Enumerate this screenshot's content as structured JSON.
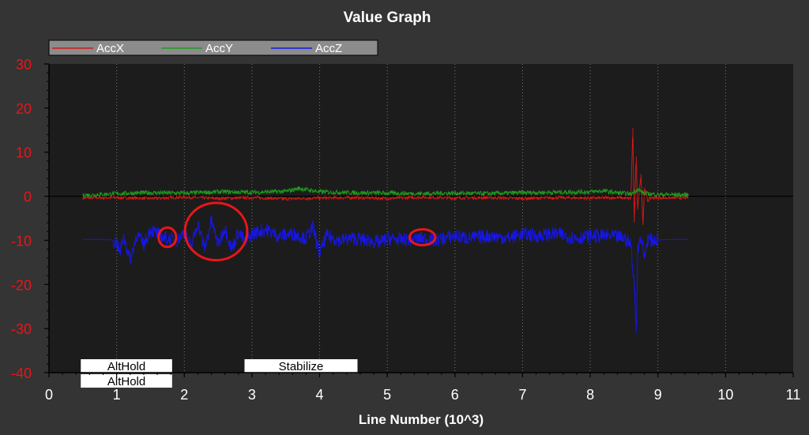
{
  "chart_data": {
    "type": "line",
    "title": "Value Graph",
    "xlabel": "Line Number (10^3)",
    "ylabel": "",
    "xlim": [
      0,
      11
    ],
    "ylim": [
      -40,
      30
    ],
    "x_ticks": [
      "0",
      "1",
      "2",
      "3",
      "4",
      "5",
      "6",
      "7",
      "8",
      "9",
      "10",
      "11"
    ],
    "y_ticks": [
      "30",
      "20",
      "10",
      "0",
      "-10",
      "-20",
      "-30",
      "-40"
    ],
    "grid": "vertical dotted",
    "legend_placement": "top-left",
    "series": [
      {
        "name": "AccX",
        "color": "#d01818",
        "points": [
          [
            0.5,
            -0.4
          ],
          [
            1.0,
            -0.3
          ],
          [
            1.5,
            -0.5
          ],
          [
            2.0,
            -0.2
          ],
          [
            2.5,
            -0.5
          ],
          [
            3.0,
            -0.3
          ],
          [
            3.5,
            -0.6
          ],
          [
            4.0,
            -0.4
          ],
          [
            4.5,
            -0.3
          ],
          [
            5.0,
            -0.5
          ],
          [
            5.5,
            -0.2
          ],
          [
            6.0,
            -0.4
          ],
          [
            6.5,
            -0.3
          ],
          [
            7.0,
            -0.5
          ],
          [
            7.5,
            -0.3
          ],
          [
            8.0,
            -0.4
          ],
          [
            8.4,
            -0.3
          ],
          [
            8.6,
            -0.5
          ],
          [
            8.63,
            15.5
          ],
          [
            8.65,
            -6.0
          ],
          [
            8.68,
            9.0
          ],
          [
            8.7,
            -3.0
          ],
          [
            8.75,
            5.0
          ],
          [
            8.78,
            -6.5
          ],
          [
            8.8,
            2.0
          ],
          [
            8.85,
            -1.0
          ],
          [
            8.9,
            -0.3
          ],
          [
            9.2,
            -0.4
          ],
          [
            9.45,
            -0.3
          ]
        ]
      },
      {
        "name": "AccY",
        "color": "#1e9a1e",
        "points": [
          [
            0.5,
            0.2
          ],
          [
            1.0,
            0.6
          ],
          [
            1.5,
            0.8
          ],
          [
            2.0,
            0.7
          ],
          [
            2.5,
            1.0
          ],
          [
            3.0,
            0.9
          ],
          [
            3.5,
            1.1
          ],
          [
            3.7,
            1.8
          ],
          [
            4.0,
            1.0
          ],
          [
            4.5,
            0.8
          ],
          [
            5.0,
            0.7
          ],
          [
            5.5,
            0.6
          ],
          [
            6.0,
            0.7
          ],
          [
            6.5,
            0.6
          ],
          [
            7.0,
            0.8
          ],
          [
            7.5,
            0.9
          ],
          [
            8.0,
            1.0
          ],
          [
            8.2,
            1.2
          ],
          [
            8.4,
            0.8
          ],
          [
            8.6,
            0.5
          ],
          [
            8.7,
            1.5
          ],
          [
            8.8,
            0.6
          ],
          [
            9.0,
            0.4
          ],
          [
            9.45,
            0.3
          ]
        ]
      },
      {
        "name": "AccZ",
        "color": "#1616e8",
        "points": [
          [
            0.5,
            -9.8
          ],
          [
            0.9,
            -9.8
          ],
          [
            1.0,
            -10.5
          ],
          [
            1.05,
            -13.0
          ],
          [
            1.1,
            -9.0
          ],
          [
            1.2,
            -14.5
          ],
          [
            1.3,
            -8.5
          ],
          [
            1.4,
            -11.0
          ],
          [
            1.5,
            -7.5
          ],
          [
            1.7,
            -9.5
          ],
          [
            1.9,
            -10.0
          ],
          [
            2.0,
            -8.0
          ],
          [
            2.1,
            -11.5
          ],
          [
            2.2,
            -6.0
          ],
          [
            2.3,
            -12.0
          ],
          [
            2.4,
            -5.5
          ],
          [
            2.5,
            -11.0
          ],
          [
            2.6,
            -7.0
          ],
          [
            2.7,
            -12.0
          ],
          [
            2.8,
            -8.0
          ],
          [
            2.9,
            -10.5
          ],
          [
            3.0,
            -8.5
          ],
          [
            3.2,
            -7.5
          ],
          [
            3.4,
            -9.0
          ],
          [
            3.6,
            -8.5
          ],
          [
            3.8,
            -9.5
          ],
          [
            3.9,
            -7.0
          ],
          [
            4.0,
            -13.0
          ],
          [
            4.1,
            -9.0
          ],
          [
            4.3,
            -10.0
          ],
          [
            4.5,
            -9.5
          ],
          [
            4.7,
            -10.0
          ],
          [
            4.9,
            -10.5
          ],
          [
            5.0,
            -9.5
          ],
          [
            5.2,
            -10.0
          ],
          [
            5.5,
            -9.5
          ],
          [
            5.7,
            -10.0
          ],
          [
            6.0,
            -9.0
          ],
          [
            6.2,
            -9.5
          ],
          [
            6.5,
            -9.0
          ],
          [
            6.8,
            -9.5
          ],
          [
            7.0,
            -8.5
          ],
          [
            7.2,
            -9.0
          ],
          [
            7.5,
            -8.5
          ],
          [
            7.8,
            -9.5
          ],
          [
            8.0,
            -9.0
          ],
          [
            8.3,
            -9.0
          ],
          [
            8.5,
            -9.5
          ],
          [
            8.6,
            -11.0
          ],
          [
            8.65,
            -20.0
          ],
          [
            8.68,
            -31.0
          ],
          [
            8.7,
            -12.0
          ],
          [
            8.75,
            -9.0
          ],
          [
            8.8,
            -14.0
          ],
          [
            8.85,
            -9.5
          ],
          [
            8.9,
            -10.0
          ],
          [
            9.2,
            -9.8
          ],
          [
            9.45,
            -9.8
          ]
        ]
      }
    ],
    "annotations": [
      {
        "type": "ellipse",
        "color": "#e8161a",
        "center": [
          1.75,
          -9.3
        ],
        "radius_x": 0.13,
        "radius_y": 2.2
      },
      {
        "type": "ellipse",
        "color": "#e8161a",
        "center": [
          2.47,
          -8.0
        ],
        "radius_x": 0.46,
        "radius_y": 6.5
      },
      {
        "type": "ellipse",
        "color": "#e8161a",
        "center": [
          5.52,
          -9.3
        ],
        "radius_x": 0.19,
        "radius_y": 1.8
      }
    ],
    "flight_modes": [
      {
        "label": "AltHold",
        "start": 0.47,
        "end": 1.82,
        "row": 0
      },
      {
        "label": "AltHold",
        "start": 0.47,
        "end": 1.82,
        "row": 1
      },
      {
        "label": "Stabilize",
        "start": 2.89,
        "end": 4.56,
        "row": 0
      }
    ]
  }
}
